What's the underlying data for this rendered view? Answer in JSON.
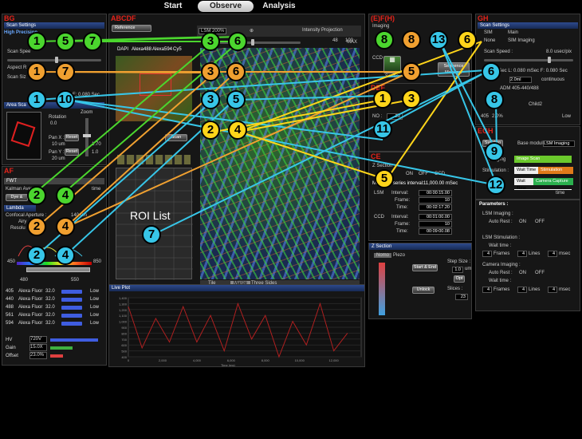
{
  "top_tabs": [
    "Start",
    "Observe",
    "Analysis"
  ],
  "panels": {
    "bg": {
      "title": "BG",
      "scan_settings": "Scan Settings",
      "high_precision": "High Precision",
      "scan_speed": "Scan Spee",
      "aspect": "Aspect R",
      "scan_size": "Scan Siz",
      "f_value": "F: 0.080 Sec",
      "area_scan": "Area Sca",
      "rotation_label": "Rotation",
      "rotation_value": "0.0",
      "pan_x_label": "Pan X :",
      "pan_x_value": "10 um",
      "pan_y_label": "Pan Y :",
      "pan_y_value": "20 um",
      "reset_label": "Reset",
      "zoom_label": "Zoom",
      "zoom_value1": "1.70",
      "zoom_value2": "1.0"
    },
    "af": {
      "title": "AF",
      "fwt": "FWT",
      "kalman": "Kalman Aver",
      "kalman_value": "time",
      "dye_label": "Dye &",
      "lambda_label": "Lambda",
      "confocal": "Confocal Aperture :",
      "confocal_value": "140 um",
      "airy": "Airy",
      "resolution": "Resolu",
      "range_low": "450",
      "range_high": "850",
      "range_mid_low": "480",
      "range_mid_high": "550",
      "channels": [
        {
          "wl": "405",
          "dye": "Alexa Fluor",
          "pct": "32.0",
          "gain": "Low",
          "color": "#3f5de0"
        },
        {
          "wl": "440",
          "dye": "Alexa Fluor",
          "pct": "32.0",
          "gain": "Low",
          "color": "#3f5de0"
        },
        {
          "wl": "488",
          "dye": "Alexa Fluor",
          "pct": "32.0",
          "gain": "Low",
          "color": "#3f5de0"
        },
        {
          "wl": "561",
          "dye": "Alexa Fluor",
          "pct": "32.0",
          "gain": "Low",
          "color": "#3f5de0"
        },
        {
          "wl": "594",
          "dye": "Alexa Fluor",
          "pct": "32.0",
          "gain": "Low",
          "color": "#3f5de0"
        }
      ],
      "hv_label": "HV",
      "hv_value": "720V",
      "gain_label": "Gain",
      "gain_value": "15.0X",
      "offset_label": "Offset",
      "offset_value": "23.0%"
    },
    "abcdf": {
      "title": "ABCDF",
      "reference": "Reference",
      "channel_tabs": [
        "DAPI",
        "Alexa488",
        "Alexa594",
        "Cy5"
      ],
      "zoom_pct": "LSM 200%",
      "projection": "Intensity Projection",
      "z_value": "48",
      "z_max": "100",
      "max_label": "MAX",
      "scan_btn": "Scan",
      "roi_label": "ROI List",
      "view_tabs": [
        "Tile",
        "Marge",
        "Three Sides"
      ]
    },
    "efh": {
      "title": "(E)F(H)",
      "imaging": "Imaging",
      "ccd": "CCD",
      "series": "Series",
      "sequence_manager": "Sequence Manager"
    },
    "def": {
      "title": "DEF",
      "no_label": "NO :",
      "no_value": "20",
      "ce_title": "CE",
      "z_section_label": "Z Section",
      "on": "ON",
      "off": "OFF",
      "ccd": "CCD",
      "lsm": "LSM",
      "minimum_interval": "Minimum series interval:",
      "minimum_interval_value": "11,000.00 mSec",
      "lsm_interval": "00:00:15.00",
      "lsm_frame": "10",
      "lsm_time": "00:02:17.20",
      "ccd_interval": "00:01:00.00",
      "ccd_frame": "10",
      "ccd_time": "00:09:00.08",
      "interval_label": "Interval:",
      "frame_label": "Frame:",
      "time_label": "Time:"
    },
    "zsection": {
      "title": "Z Section",
      "tabs": [
        "Nomo",
        "Piezo"
      ],
      "start_end": "Start & End",
      "step_size_label": "Step Size :",
      "step_size_value": "1.0",
      "step_unit": "um",
      "opt_label": "Opt",
      "slices_label": "Slices :",
      "slices_value": "23",
      "unlock_label": "Unlock"
    },
    "gh": {
      "title": "GH",
      "scan_settings": "Scan Settings",
      "sim_label": "SIM",
      "main_label": "Main",
      "none_label": "None",
      "sim_imaging": "SIM Imaging",
      "scan_speed_label": "Scan Speed :",
      "scan_speed_value": "8.0 usec/pix",
      "usec_value": "0 uSec L: 0.080 mSec F: 0.080 Sec",
      "zoom_value": "2.0ml",
      "continuous": "continuous",
      "adm_label": "ADM 405-440/488",
      "child_label": "Child2",
      "laser_wl": "405",
      "laser_pct": "2.0%",
      "laser_gain": "Low"
    },
    "egh": {
      "title": "EGH",
      "synchro": "Synchro",
      "base_module": "Base module",
      "lsm_imaging_select": "LSM Imaging",
      "imaging_label": "Imaging",
      "stimulation_label": "Stimulation :",
      "image_scan": "Image Scan",
      "wait_time": "Wait Time",
      "stimulation": "Stimulation",
      "camera_capture": "Camera Capture",
      "time_axis": "time"
    },
    "params": {
      "title": "Parameters :",
      "lsm_imaging": "LSM Imaging :",
      "auto_rest": "Auto Rest :",
      "on": "ON",
      "off": "OFF",
      "wait_time": "Wait time :",
      "frames_value": "4",
      "frames_label": "Frames",
      "lines_value": "4",
      "lines_label": "Lines",
      "msec_value": "4",
      "msec_label": "msec",
      "lsm_stimulation": "LSM Stimulation :",
      "camera_imaging": "Camera Imaging :"
    },
    "live_plot": {
      "title": "Live Plot",
      "x_ticks": [
        "0",
        "2,000",
        "4,000",
        "6,000",
        "8,000",
        "10,000",
        "12,000"
      ],
      "y_ticks": [
        "1,400",
        "1,300",
        "1,200",
        "1,100",
        "1,000",
        "900",
        "800",
        "700",
        "600",
        "500",
        "400"
      ],
      "xlabel": "Time (ms)"
    }
  },
  "chart_data": {
    "type": "line",
    "title": "Live Plot",
    "xlabel": "Time (ms)",
    "ylabel": "",
    "xlim": [
      0,
      12000
    ],
    "ylim": [
      400,
      1400
    ],
    "series": [
      {
        "x": [
          0,
          800,
          1600,
          2400,
          3200,
          4000,
          4800,
          5600,
          6400,
          7200,
          8000,
          8800,
          9600,
          10400,
          11200,
          12000,
          12800
        ],
        "values": [
          1250,
          550,
          1050,
          650,
          1250,
          650,
          1100,
          500,
          1300,
          700,
          1100,
          400,
          1000,
          600,
          1300,
          500,
          800
        ],
        "color": "#b02020"
      }
    ]
  },
  "callouts": [
    {
      "label": "1",
      "color": "green"
    },
    {
      "label": "5",
      "color": "green"
    },
    {
      "label": "7",
      "color": "green"
    },
    {
      "label": "1",
      "color": "orange"
    },
    {
      "label": "7",
      "color": "orange"
    },
    {
      "label": "1",
      "color": "cyan"
    },
    {
      "label": "10",
      "color": "cyan"
    },
    {
      "label": "3",
      "color": "green"
    },
    {
      "label": "6",
      "color": "green"
    },
    {
      "label": "3",
      "color": "orange"
    },
    {
      "label": "6",
      "color": "orange"
    },
    {
      "label": "3",
      "color": "cyan"
    },
    {
      "label": "5",
      "color": "cyan"
    },
    {
      "label": "2",
      "color": "yellow"
    },
    {
      "label": "4",
      "color": "yellow"
    },
    {
      "label": "2",
      "color": "green"
    },
    {
      "label": "4",
      "color": "green"
    },
    {
      "label": "2",
      "color": "orange"
    },
    {
      "label": "4",
      "color": "orange"
    },
    {
      "label": "2",
      "color": "cyan"
    },
    {
      "label": "4",
      "color": "cyan"
    },
    {
      "label": "7",
      "color": "cyan"
    },
    {
      "label": "8",
      "color": "green"
    },
    {
      "label": "8",
      "color": "orange"
    },
    {
      "label": "13",
      "color": "cyan"
    },
    {
      "label": "6",
      "color": "yellow"
    },
    {
      "label": "5",
      "color": "orange"
    },
    {
      "label": "1",
      "color": "yellow"
    },
    {
      "label": "3",
      "color": "yellow"
    },
    {
      "label": "11",
      "color": "cyan"
    },
    {
      "label": "5",
      "color": "yellow"
    },
    {
      "label": "6",
      "color": "cyan"
    },
    {
      "label": "8",
      "color": "cyan"
    },
    {
      "label": "9",
      "color": "cyan"
    },
    {
      "label": "12",
      "color": "cyan"
    }
  ],
  "colors": {
    "green": "#4bd62e",
    "orange": "#f0a030",
    "yellow": "#ffd51a",
    "cyan": "#37c6e8",
    "title_red": "#e2231a"
  }
}
